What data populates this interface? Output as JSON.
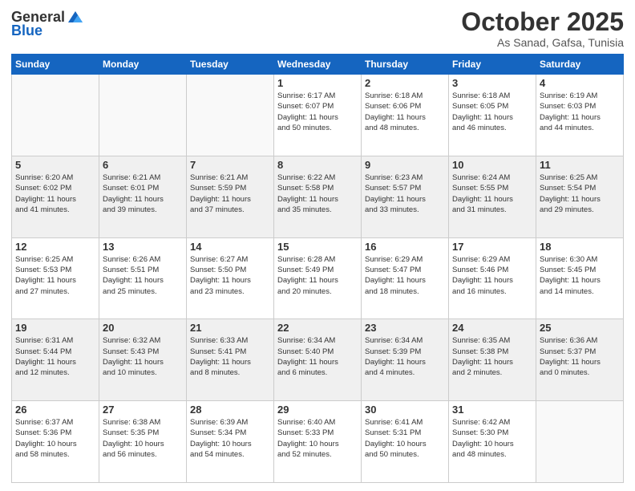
{
  "header": {
    "logo_general": "General",
    "logo_blue": "Blue",
    "month": "October 2025",
    "location": "As Sanad, Gafsa, Tunisia"
  },
  "weekdays": [
    "Sunday",
    "Monday",
    "Tuesday",
    "Wednesday",
    "Thursday",
    "Friday",
    "Saturday"
  ],
  "weeks": [
    [
      {
        "day": "",
        "info": ""
      },
      {
        "day": "",
        "info": ""
      },
      {
        "day": "",
        "info": ""
      },
      {
        "day": "1",
        "info": "Sunrise: 6:17 AM\nSunset: 6:07 PM\nDaylight: 11 hours\nand 50 minutes."
      },
      {
        "day": "2",
        "info": "Sunrise: 6:18 AM\nSunset: 6:06 PM\nDaylight: 11 hours\nand 48 minutes."
      },
      {
        "day": "3",
        "info": "Sunrise: 6:18 AM\nSunset: 6:05 PM\nDaylight: 11 hours\nand 46 minutes."
      },
      {
        "day": "4",
        "info": "Sunrise: 6:19 AM\nSunset: 6:03 PM\nDaylight: 11 hours\nand 44 minutes."
      }
    ],
    [
      {
        "day": "5",
        "info": "Sunrise: 6:20 AM\nSunset: 6:02 PM\nDaylight: 11 hours\nand 41 minutes."
      },
      {
        "day": "6",
        "info": "Sunrise: 6:21 AM\nSunset: 6:01 PM\nDaylight: 11 hours\nand 39 minutes."
      },
      {
        "day": "7",
        "info": "Sunrise: 6:21 AM\nSunset: 5:59 PM\nDaylight: 11 hours\nand 37 minutes."
      },
      {
        "day": "8",
        "info": "Sunrise: 6:22 AM\nSunset: 5:58 PM\nDaylight: 11 hours\nand 35 minutes."
      },
      {
        "day": "9",
        "info": "Sunrise: 6:23 AM\nSunset: 5:57 PM\nDaylight: 11 hours\nand 33 minutes."
      },
      {
        "day": "10",
        "info": "Sunrise: 6:24 AM\nSunset: 5:55 PM\nDaylight: 11 hours\nand 31 minutes."
      },
      {
        "day": "11",
        "info": "Sunrise: 6:25 AM\nSunset: 5:54 PM\nDaylight: 11 hours\nand 29 minutes."
      }
    ],
    [
      {
        "day": "12",
        "info": "Sunrise: 6:25 AM\nSunset: 5:53 PM\nDaylight: 11 hours\nand 27 minutes."
      },
      {
        "day": "13",
        "info": "Sunrise: 6:26 AM\nSunset: 5:51 PM\nDaylight: 11 hours\nand 25 minutes."
      },
      {
        "day": "14",
        "info": "Sunrise: 6:27 AM\nSunset: 5:50 PM\nDaylight: 11 hours\nand 23 minutes."
      },
      {
        "day": "15",
        "info": "Sunrise: 6:28 AM\nSunset: 5:49 PM\nDaylight: 11 hours\nand 20 minutes."
      },
      {
        "day": "16",
        "info": "Sunrise: 6:29 AM\nSunset: 5:47 PM\nDaylight: 11 hours\nand 18 minutes."
      },
      {
        "day": "17",
        "info": "Sunrise: 6:29 AM\nSunset: 5:46 PM\nDaylight: 11 hours\nand 16 minutes."
      },
      {
        "day": "18",
        "info": "Sunrise: 6:30 AM\nSunset: 5:45 PM\nDaylight: 11 hours\nand 14 minutes."
      }
    ],
    [
      {
        "day": "19",
        "info": "Sunrise: 6:31 AM\nSunset: 5:44 PM\nDaylight: 11 hours\nand 12 minutes."
      },
      {
        "day": "20",
        "info": "Sunrise: 6:32 AM\nSunset: 5:43 PM\nDaylight: 11 hours\nand 10 minutes."
      },
      {
        "day": "21",
        "info": "Sunrise: 6:33 AM\nSunset: 5:41 PM\nDaylight: 11 hours\nand 8 minutes."
      },
      {
        "day": "22",
        "info": "Sunrise: 6:34 AM\nSunset: 5:40 PM\nDaylight: 11 hours\nand 6 minutes."
      },
      {
        "day": "23",
        "info": "Sunrise: 6:34 AM\nSunset: 5:39 PM\nDaylight: 11 hours\nand 4 minutes."
      },
      {
        "day": "24",
        "info": "Sunrise: 6:35 AM\nSunset: 5:38 PM\nDaylight: 11 hours\nand 2 minutes."
      },
      {
        "day": "25",
        "info": "Sunrise: 6:36 AM\nSunset: 5:37 PM\nDaylight: 11 hours\nand 0 minutes."
      }
    ],
    [
      {
        "day": "26",
        "info": "Sunrise: 6:37 AM\nSunset: 5:36 PM\nDaylight: 10 hours\nand 58 minutes."
      },
      {
        "day": "27",
        "info": "Sunrise: 6:38 AM\nSunset: 5:35 PM\nDaylight: 10 hours\nand 56 minutes."
      },
      {
        "day": "28",
        "info": "Sunrise: 6:39 AM\nSunset: 5:34 PM\nDaylight: 10 hours\nand 54 minutes."
      },
      {
        "day": "29",
        "info": "Sunrise: 6:40 AM\nSunset: 5:33 PM\nDaylight: 10 hours\nand 52 minutes."
      },
      {
        "day": "30",
        "info": "Sunrise: 6:41 AM\nSunset: 5:31 PM\nDaylight: 10 hours\nand 50 minutes."
      },
      {
        "day": "31",
        "info": "Sunrise: 6:42 AM\nSunset: 5:30 PM\nDaylight: 10 hours\nand 48 minutes."
      },
      {
        "day": "",
        "info": ""
      }
    ]
  ]
}
